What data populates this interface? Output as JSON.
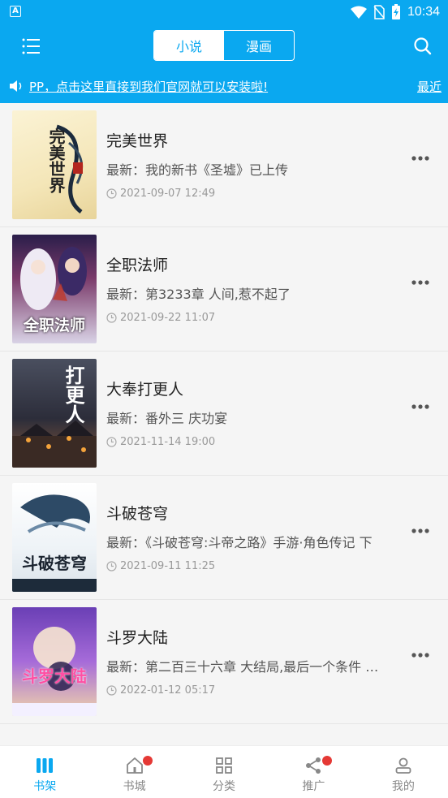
{
  "status": {
    "time": "10:34"
  },
  "tabs": [
    {
      "label": "小说",
      "active": true
    },
    {
      "label": "漫画",
      "active": false
    }
  ],
  "notice": {
    "message": "PP，点击这里直接到我们官网就可以安装啦!",
    "recent": "最近"
  },
  "books": [
    {
      "title": "完美世界",
      "latest": "最新：我的新书《圣墟》已上传",
      "date": "2021-09-07 12:49",
      "cover_text": "完美世界"
    },
    {
      "title": "全职法师",
      "latest": "最新：第3233章 人间,惹不起了",
      "date": "2021-09-22 11:07",
      "cover_text": "全职法师"
    },
    {
      "title": "大奉打更人",
      "latest": "最新：番外三 庆功宴",
      "date": "2021-11-14 19:00",
      "cover_text": "打更人"
    },
    {
      "title": "斗破苍穹",
      "latest": "最新：《斗破苍穹:斗帝之路》手游·角色传记 下",
      "date": "2021-09-11 11:25",
      "cover_text": "斗破苍穹"
    },
    {
      "title": "斗罗大陆",
      "latest": "最新：第二百三十六章 大结局,最后一个条件 全...",
      "date": "2022-01-12 05:17",
      "cover_text": "斗罗大陆"
    }
  ],
  "bottom_nav": [
    {
      "label": "书架",
      "icon": "bookshelf-icon",
      "active": true,
      "badge": false
    },
    {
      "label": "书城",
      "icon": "home-icon",
      "active": false,
      "badge": true
    },
    {
      "label": "分类",
      "icon": "category-icon",
      "active": false,
      "badge": false
    },
    {
      "label": "推广",
      "icon": "share-icon",
      "active": false,
      "badge": true
    },
    {
      "label": "我的",
      "icon": "user-icon",
      "active": false,
      "badge": false
    }
  ],
  "colors": {
    "accent": "#0aa8f0",
    "badge": "#e53935"
  }
}
